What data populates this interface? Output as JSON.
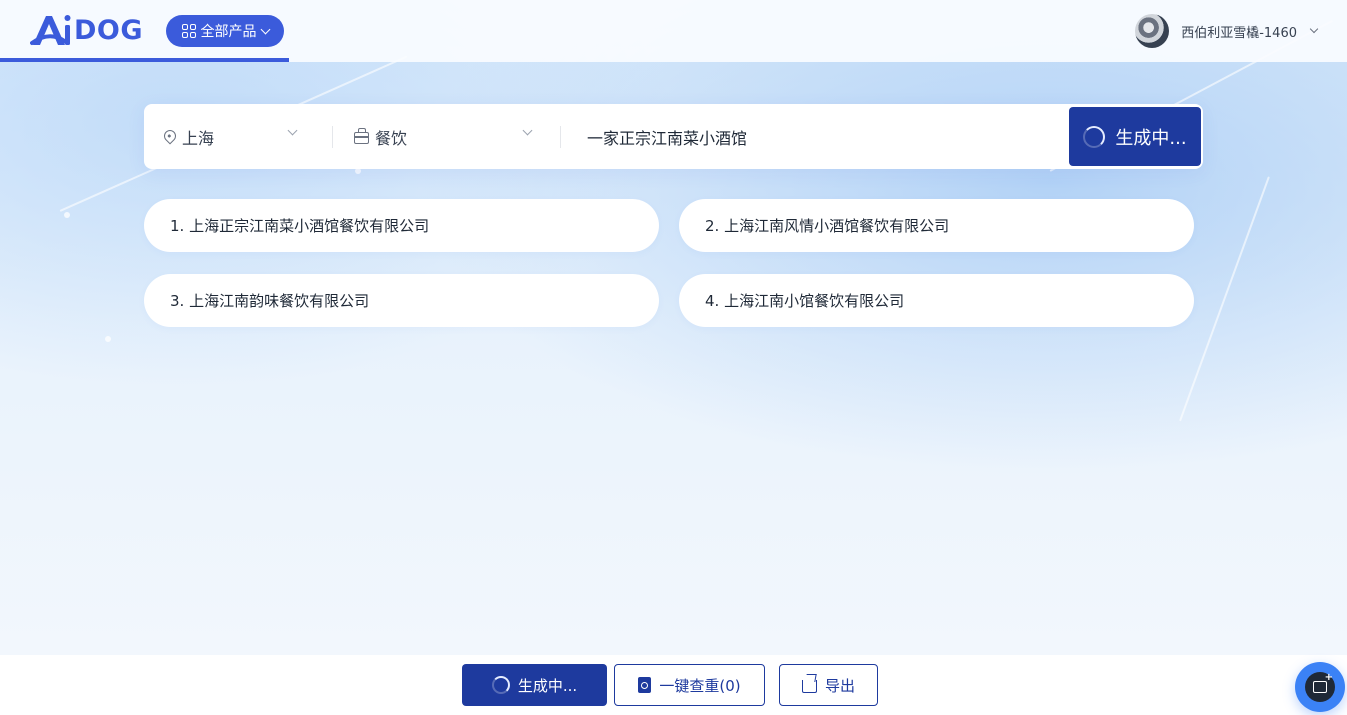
{
  "header": {
    "logo_text": "DOG",
    "all_products_label": "全部产品",
    "user_name": "西伯利亚雪橇-1460"
  },
  "search": {
    "city": "上海",
    "industry": "餐饮",
    "query": "一家正宗江南菜小酒馆",
    "generate_label": "生成中..."
  },
  "results": [
    {
      "label": "1. 上海正宗江南菜小酒馆餐饮有限公司"
    },
    {
      "label": "2. 上海江南风情小酒馆餐饮有限公司"
    },
    {
      "label": "3. 上海江南韵味餐饮有限公司"
    },
    {
      "label": "4. 上海江南小馆餐饮有限公司"
    }
  ],
  "footer": {
    "generate_label": "生成中...",
    "check_label": "一键查重(0)",
    "export_label": "导出"
  },
  "colors": {
    "accent": "#3b5bdb",
    "button_dark": "#1e3a9e",
    "float_button": "#3b82f6"
  },
  "icons": [
    "apps-grid-icon",
    "chevron-down-icon",
    "location-pin-icon",
    "briefcase-icon",
    "loading-spinner-icon",
    "document-search-icon",
    "share-export-icon",
    "add-image-icon"
  ]
}
